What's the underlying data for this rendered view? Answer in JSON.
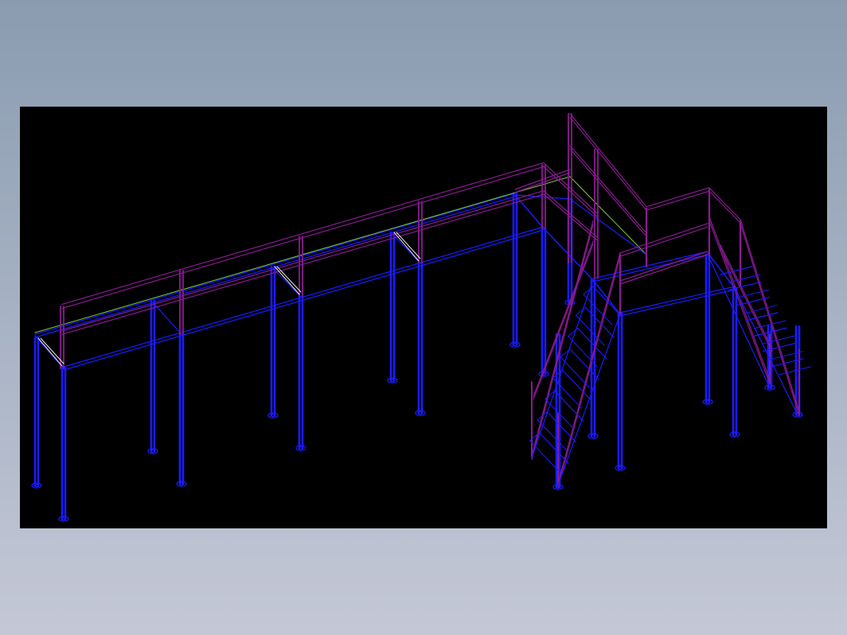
{
  "drawing": {
    "background": "#000000",
    "frame_background": "#9aa7ba",
    "colors": {
      "structure": "#1b1bff",
      "railing": "#8a1a92",
      "railing_highlight": "#c040c8",
      "edge_line": "#7acc33",
      "bracket": "#e8e8e8"
    },
    "layers": [
      "support-columns",
      "deck-frame",
      "handrails",
      "stairs"
    ]
  }
}
